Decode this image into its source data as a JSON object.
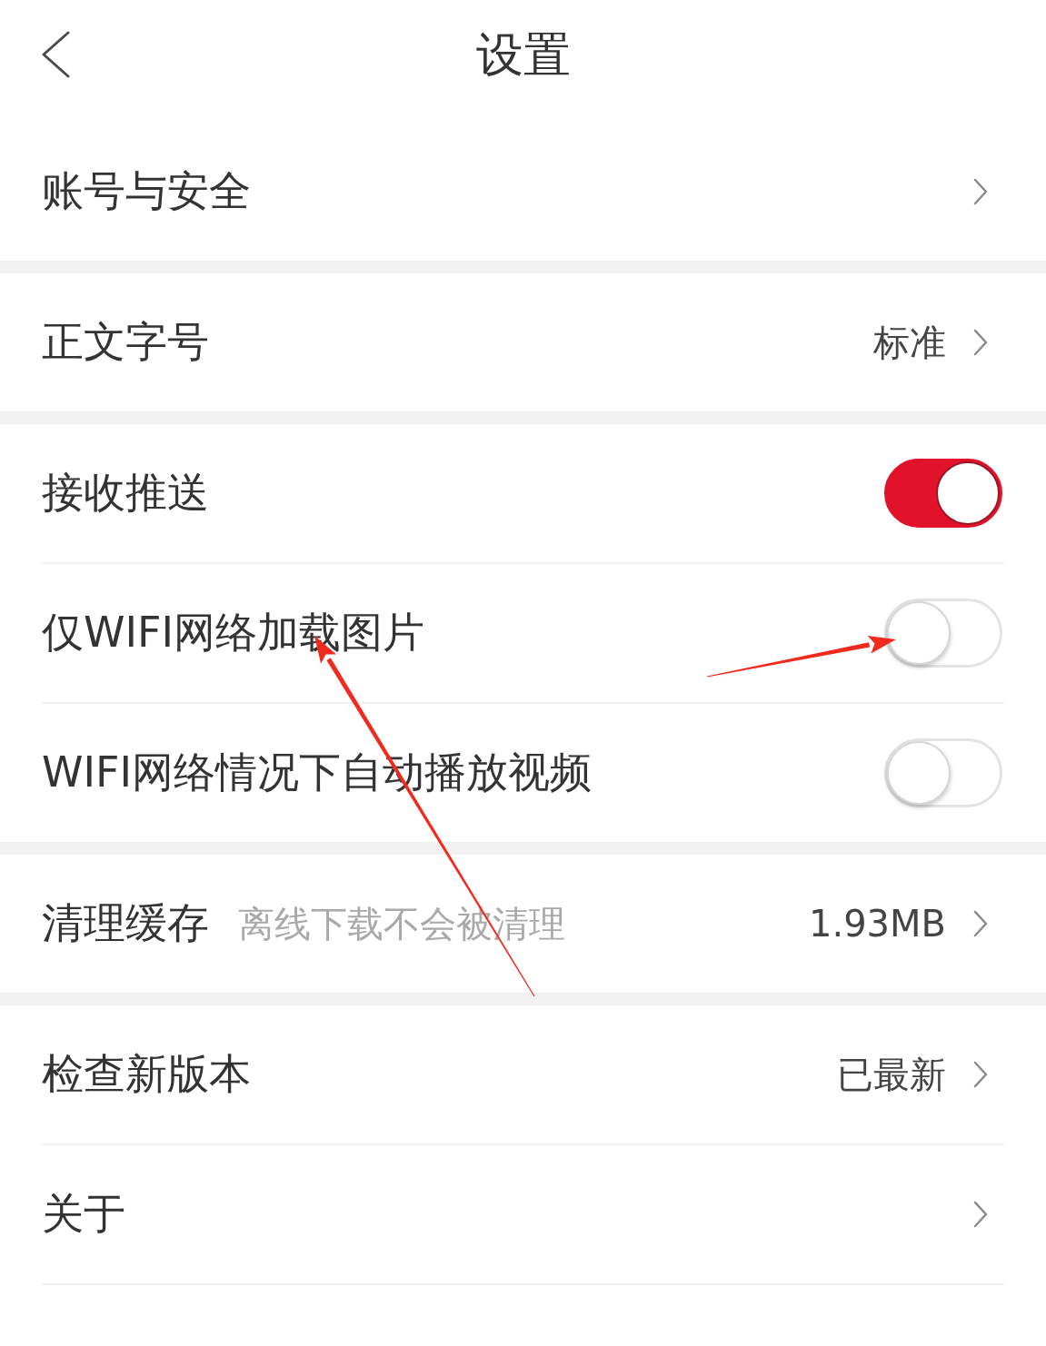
{
  "header": {
    "title": "设置"
  },
  "sections": [
    {
      "items": [
        {
          "kind": "link",
          "label": "账号与安全"
        }
      ]
    },
    {
      "items": [
        {
          "kind": "link",
          "label": "正文字号",
          "value": "标准"
        }
      ]
    },
    {
      "items": [
        {
          "kind": "toggle",
          "label": "接收推送",
          "on": true
        },
        {
          "kind": "toggle",
          "label": "仅WIFI网络加载图片",
          "on": false
        },
        {
          "kind": "toggle",
          "label": "WIFI网络情况下自动播放视频",
          "on": false
        }
      ]
    },
    {
      "items": [
        {
          "kind": "link",
          "label": "清理缓存",
          "note": "离线下载不会被清理",
          "value": "1.93MB"
        }
      ]
    },
    {
      "items": [
        {
          "kind": "link",
          "label": "检查新版本",
          "value": "已最新"
        },
        {
          "kind": "link",
          "label": "关于"
        }
      ]
    }
  ]
}
